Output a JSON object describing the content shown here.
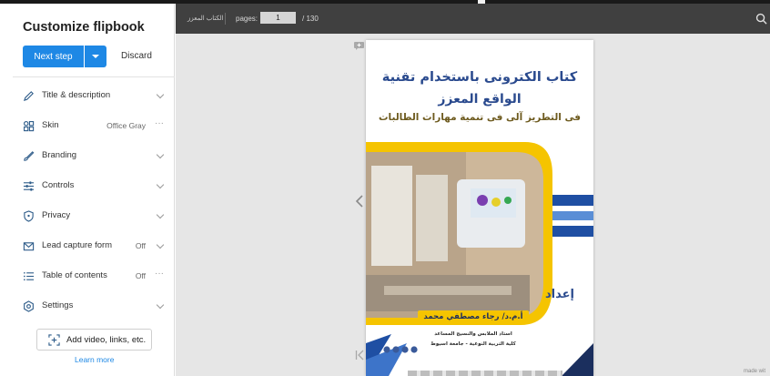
{
  "sidebar": {
    "title": "Customize flipbook",
    "next_step_label": "Next step",
    "discard_label": "Discard",
    "items": [
      {
        "label": "Title & description",
        "value": "",
        "icon": "pencil-icon",
        "control": "chevron"
      },
      {
        "label": "Skin",
        "value": "Office Gray",
        "icon": "skin-grid-icon",
        "control": "dots"
      },
      {
        "label": "Branding",
        "value": "",
        "icon": "brush-icon",
        "control": "chevron"
      },
      {
        "label": "Controls",
        "value": "",
        "icon": "sliders-icon",
        "control": "chevron"
      },
      {
        "label": "Privacy",
        "value": "",
        "icon": "shield-icon",
        "control": "chevron"
      },
      {
        "label": "Lead capture form",
        "value": "Off",
        "icon": "envelope-icon",
        "control": "chevron"
      },
      {
        "label": "Table of contents",
        "value": "Off",
        "icon": "list-icon",
        "control": "dots"
      },
      {
        "label": "Settings",
        "value": "",
        "icon": "gear-icon",
        "control": "chevron"
      }
    ],
    "add_button_label": "Add video, links, etc.",
    "learn_more_label": "Learn more"
  },
  "viewer": {
    "book_label": "الكتاب المعزز",
    "pages_label": "pages:",
    "current_page": "1",
    "total_pages": "/ 130",
    "made_label": "made wit"
  },
  "book_cover": {
    "title_line1": "كتاب الكترونى باستخدام تقنية",
    "title_line2": "الواقع المعزز",
    "subtitle": "فى التطريز آلى فى تنمية مهارات الطالبات",
    "prepared_by": "إعداد",
    "author": "أ.م.د/ رجاء مصطفي محمد",
    "author_role": "استاذ الملابس والنسيج المساعد",
    "institution": "كلية التربية النوعية - جامعة اسيوط"
  },
  "colors": {
    "accent": "#1e88e5",
    "viewer_bar": "#404040",
    "viewer_bg": "#e6e6e6",
    "cover_blue": "#2a4a8e",
    "cover_yellow": "#f5c400"
  }
}
